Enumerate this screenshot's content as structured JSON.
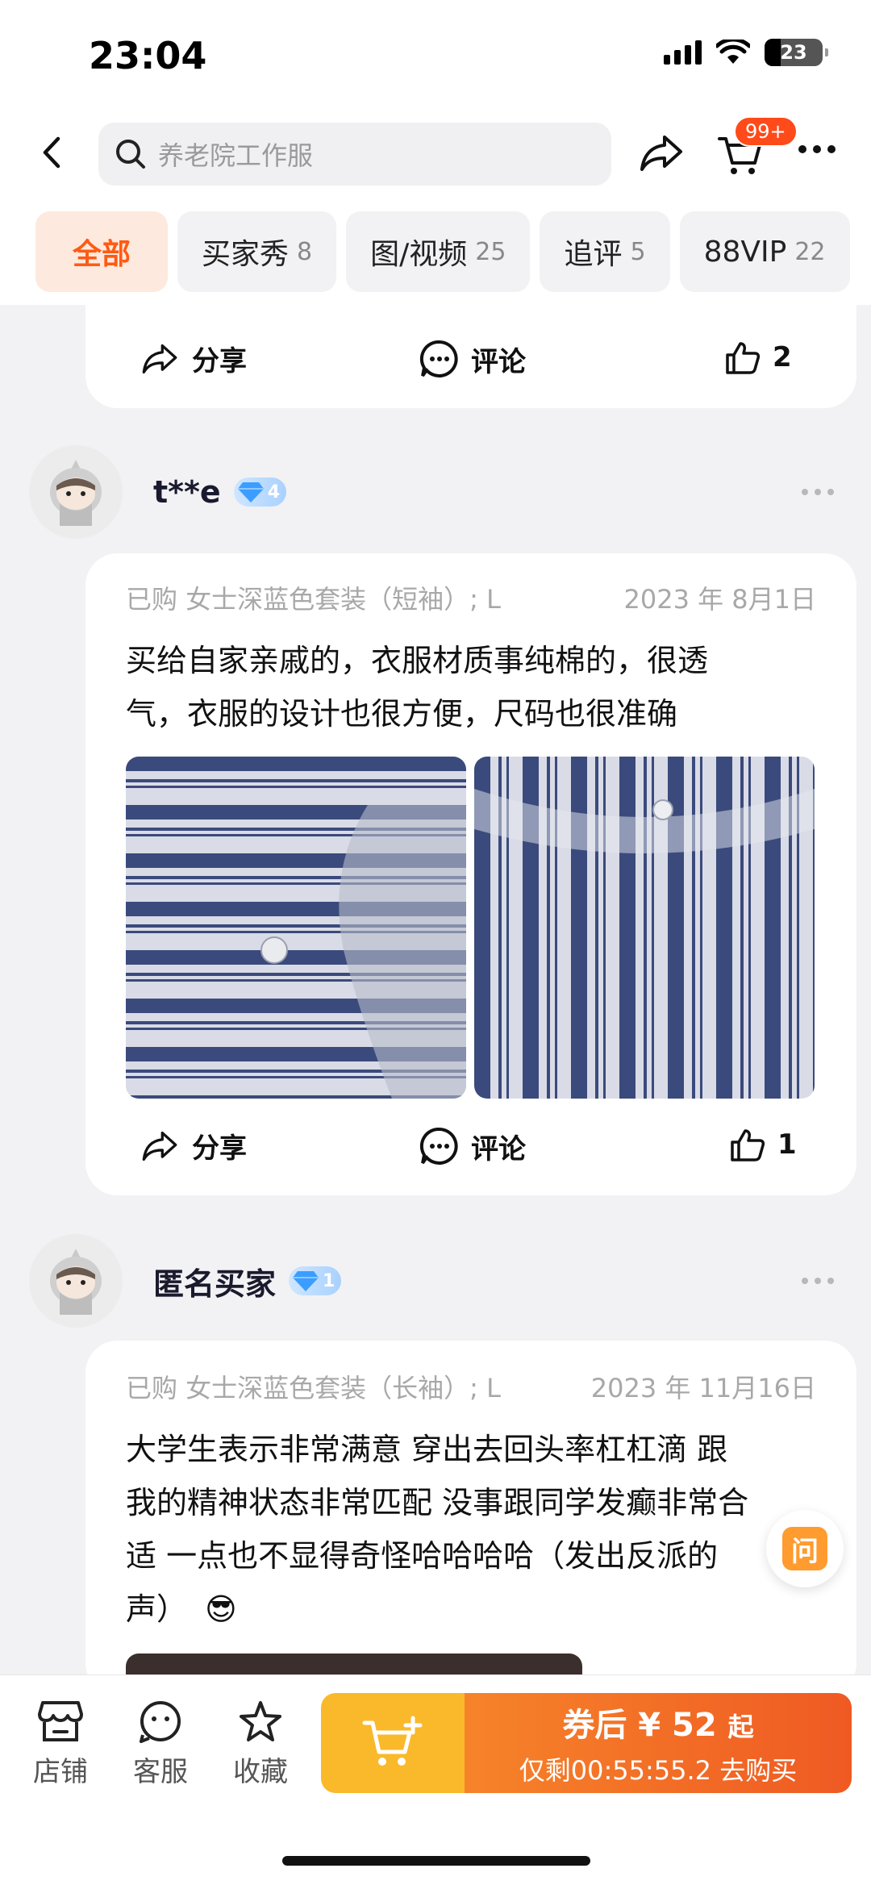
{
  "status": {
    "time": "23:04",
    "battery": "23"
  },
  "search": {
    "placeholder": "养老院工作服"
  },
  "cart": {
    "badge": "99+"
  },
  "tabs": [
    {
      "label": "全部",
      "count": ""
    },
    {
      "label": "买家秀",
      "count": "8"
    },
    {
      "label": "图/视频",
      "count": "25"
    },
    {
      "label": "追评",
      "count": "5"
    },
    {
      "label": "88VIP",
      "count": "22"
    }
  ],
  "actions": {
    "share": "分享",
    "comment": "评论"
  },
  "card0": {
    "likes": "2"
  },
  "reviews": [
    {
      "user": "t**e",
      "level": "4",
      "purchased": "已购 女士深蓝色套装（短袖）; L",
      "date": "2023 年 8月1日",
      "text_line1": "买给自家亲戚的，衣服材质事纯棉的，很透",
      "text_line2": "气，衣服的设计也很方便，尺码也很准确",
      "likes": "1"
    },
    {
      "user": "匿名买家",
      "level": "1",
      "purchased": "已购 女士深蓝色套装（长袖）; L",
      "date": "2023 年 11月16日",
      "text_line1": "大学生表示非常满意 穿出去回头率杠杠滴 跟",
      "text_line2": "我的精神状态非常匹配 没事跟同学发癫非常合",
      "text_line3": "适 一点也不显得奇怪哈哈哈哈（发出反派的",
      "text_line4": "声）",
      "emoji": "😎"
    }
  ],
  "ask": {
    "label": "问"
  },
  "bottom": {
    "store": "店铺",
    "service": "客服",
    "favorite": "收藏",
    "price_prefix": "券后 ¥ 52",
    "price_suffix": "起",
    "timer": "仅剩00:55:55.2 去购买"
  },
  "colors": {
    "accent": "#ff5a13",
    "cart_yellow": "#f9b92b",
    "buy_orange": "#ef5a23"
  }
}
